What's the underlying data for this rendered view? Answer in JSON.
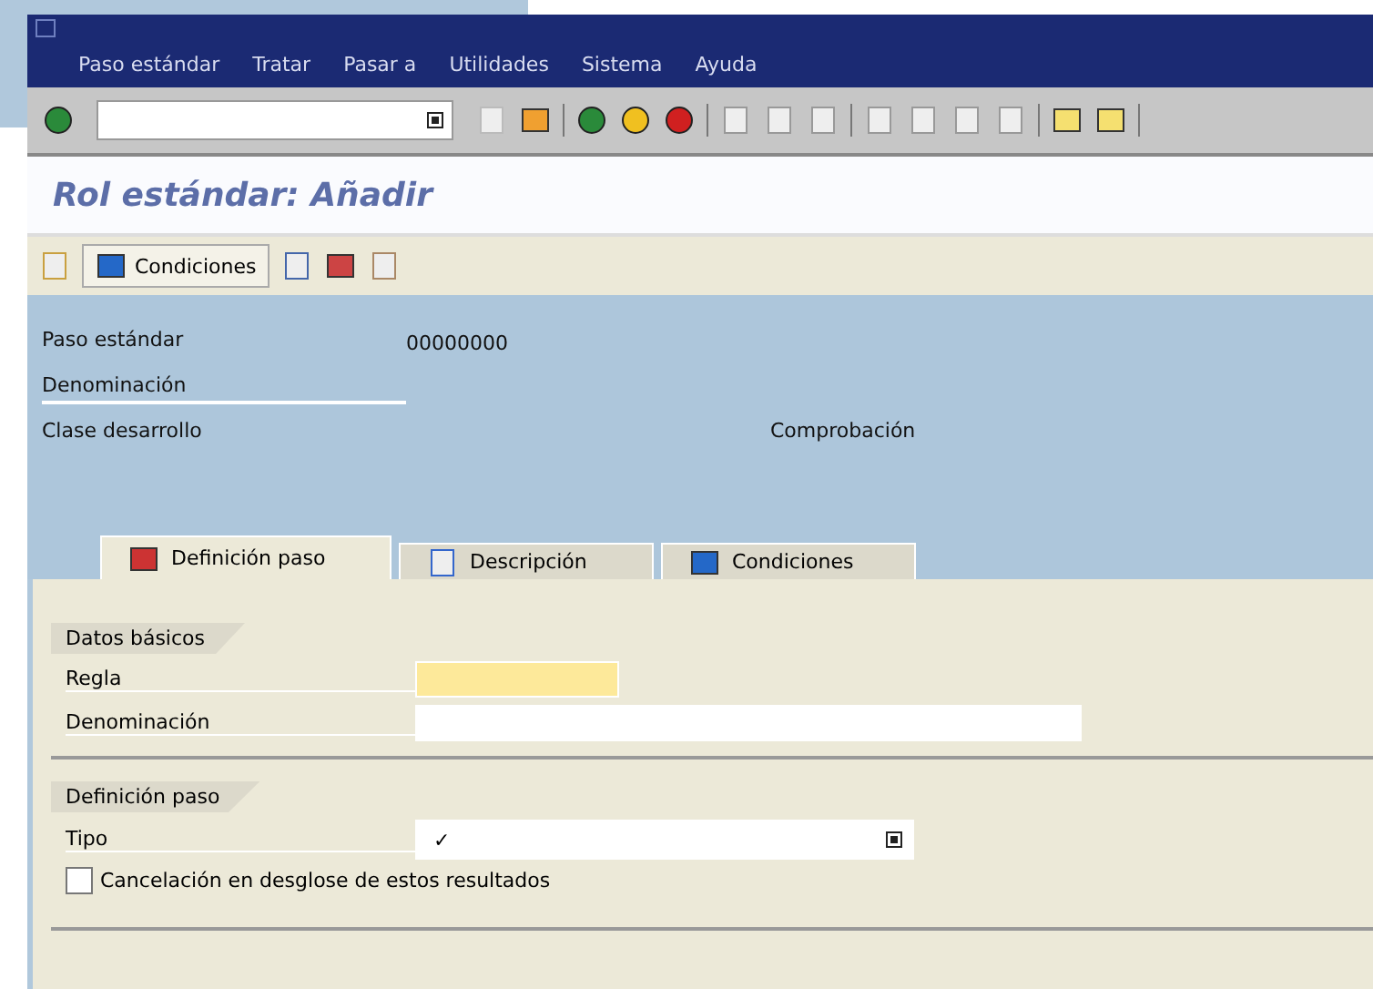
{
  "menu": [
    "Paso estándar",
    "Tratar",
    "Pasar a",
    "Utilidades",
    "Sistema",
    "Ayuda"
  ],
  "title": "Rol estándar: Añadir",
  "app_toolbar": {
    "button": "Condiciones"
  },
  "header": {
    "fields": [
      {
        "label": "Paso estándar",
        "value": "00000000",
        "underlined": false
      },
      {
        "label": "Denominación",
        "underlined": true
      }
    ],
    "row3": {
      "label": "Clase desarrollo",
      "label_2": "Comprobación"
    }
  },
  "tabs": [
    {
      "label": "Definición paso",
      "selected": true
    },
    {
      "label": "Descripción",
      "selected": false
    },
    {
      "label": "Condiciones",
      "selected": false
    }
  ],
  "groups": [
    {
      "title": "Datos básicos",
      "rows": [
        {
          "kind": "input",
          "label": "Regla",
          "required": true
        },
        {
          "kind": "input",
          "label": "Denominación",
          "required": false
        }
      ]
    },
    {
      "title": "Definición paso",
      "rows": [
        {
          "kind": "dropdown",
          "label": "Tipo",
          "value": "✓"
        },
        {
          "kind": "checkbox",
          "label": "Cancelación en desglose de estos resultados",
          "checked": false
        }
      ]
    }
  ]
}
